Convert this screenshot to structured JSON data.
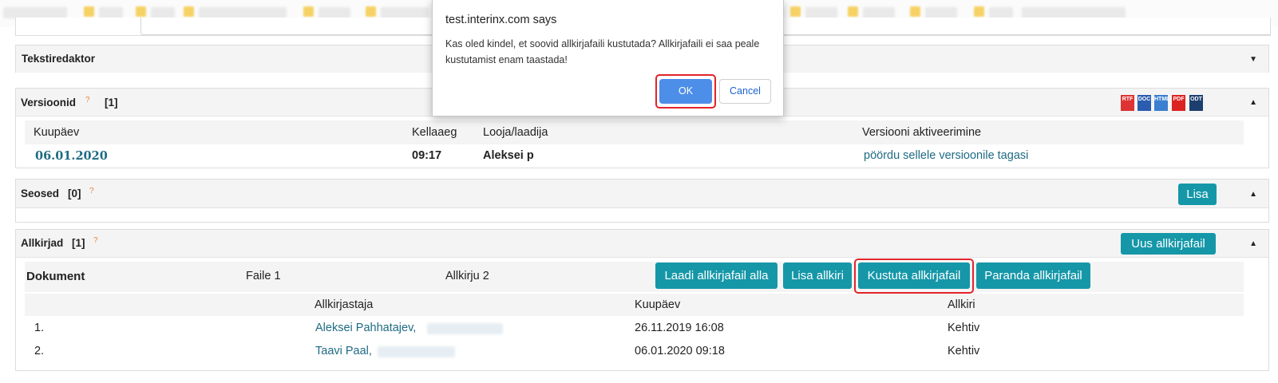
{
  "dialog": {
    "title": "test.interinx.com says",
    "message": "Kas oled kindel, et soovid allkirjafaili kustutada? Allkirjafaili ei saa peale kustutamist enam taastada!",
    "ok_label": "OK",
    "cancel_label": "Cancel"
  },
  "text_editor": {
    "title": "Tekstiredaktor"
  },
  "versions": {
    "title": "Versioonid",
    "help": "?",
    "count": "[1]",
    "export_icons": [
      "RTF",
      "DOC",
      "HTML",
      "PDF",
      "ODT"
    ],
    "columns": [
      "Kuupäev",
      "Kellaaeg",
      "Looja/laadija",
      "Versiooni aktiveerimine"
    ],
    "rows": [
      {
        "date": "06.01.2020",
        "time": "09:17",
        "author": "Aleksei p",
        "action": "pöördu sellele versioonile tagasi"
      }
    ]
  },
  "relations": {
    "title": "Seosed",
    "count": "[0]",
    "help": "?",
    "add_label": "Lisa"
  },
  "signatures": {
    "title": "Allkirjad",
    "count": "[1]",
    "help": "?",
    "new_file_label": "Uus allkirjafail",
    "document_label": "Dokument",
    "files_label": "Faile 1",
    "signatures_label": "Allkirju 2",
    "buttons": {
      "download": "Laadi allkirjafail alla",
      "add_signature": "Lisa allkiri",
      "delete": "Kustuta allkirjafail",
      "repair": "Paranda allkirjafail"
    },
    "columns": [
      "Allkirjastaja",
      "Kuupäev",
      "Allkiri"
    ],
    "rows": [
      {
        "index": "1.",
        "signer": "Aleksei Pahhatajev,",
        "date": "26.11.2019 16:08",
        "status": "Kehtiv"
      },
      {
        "index": "2.",
        "signer": "Taavi Paal,",
        "date": "06.01.2020 09:18",
        "status": "Kehtiv"
      }
    ]
  },
  "colors": {
    "accent_button": "#1597a8",
    "link": "#1e6b84",
    "highlight": "#e2242b",
    "dialog_ok": "#4d8ee8"
  }
}
